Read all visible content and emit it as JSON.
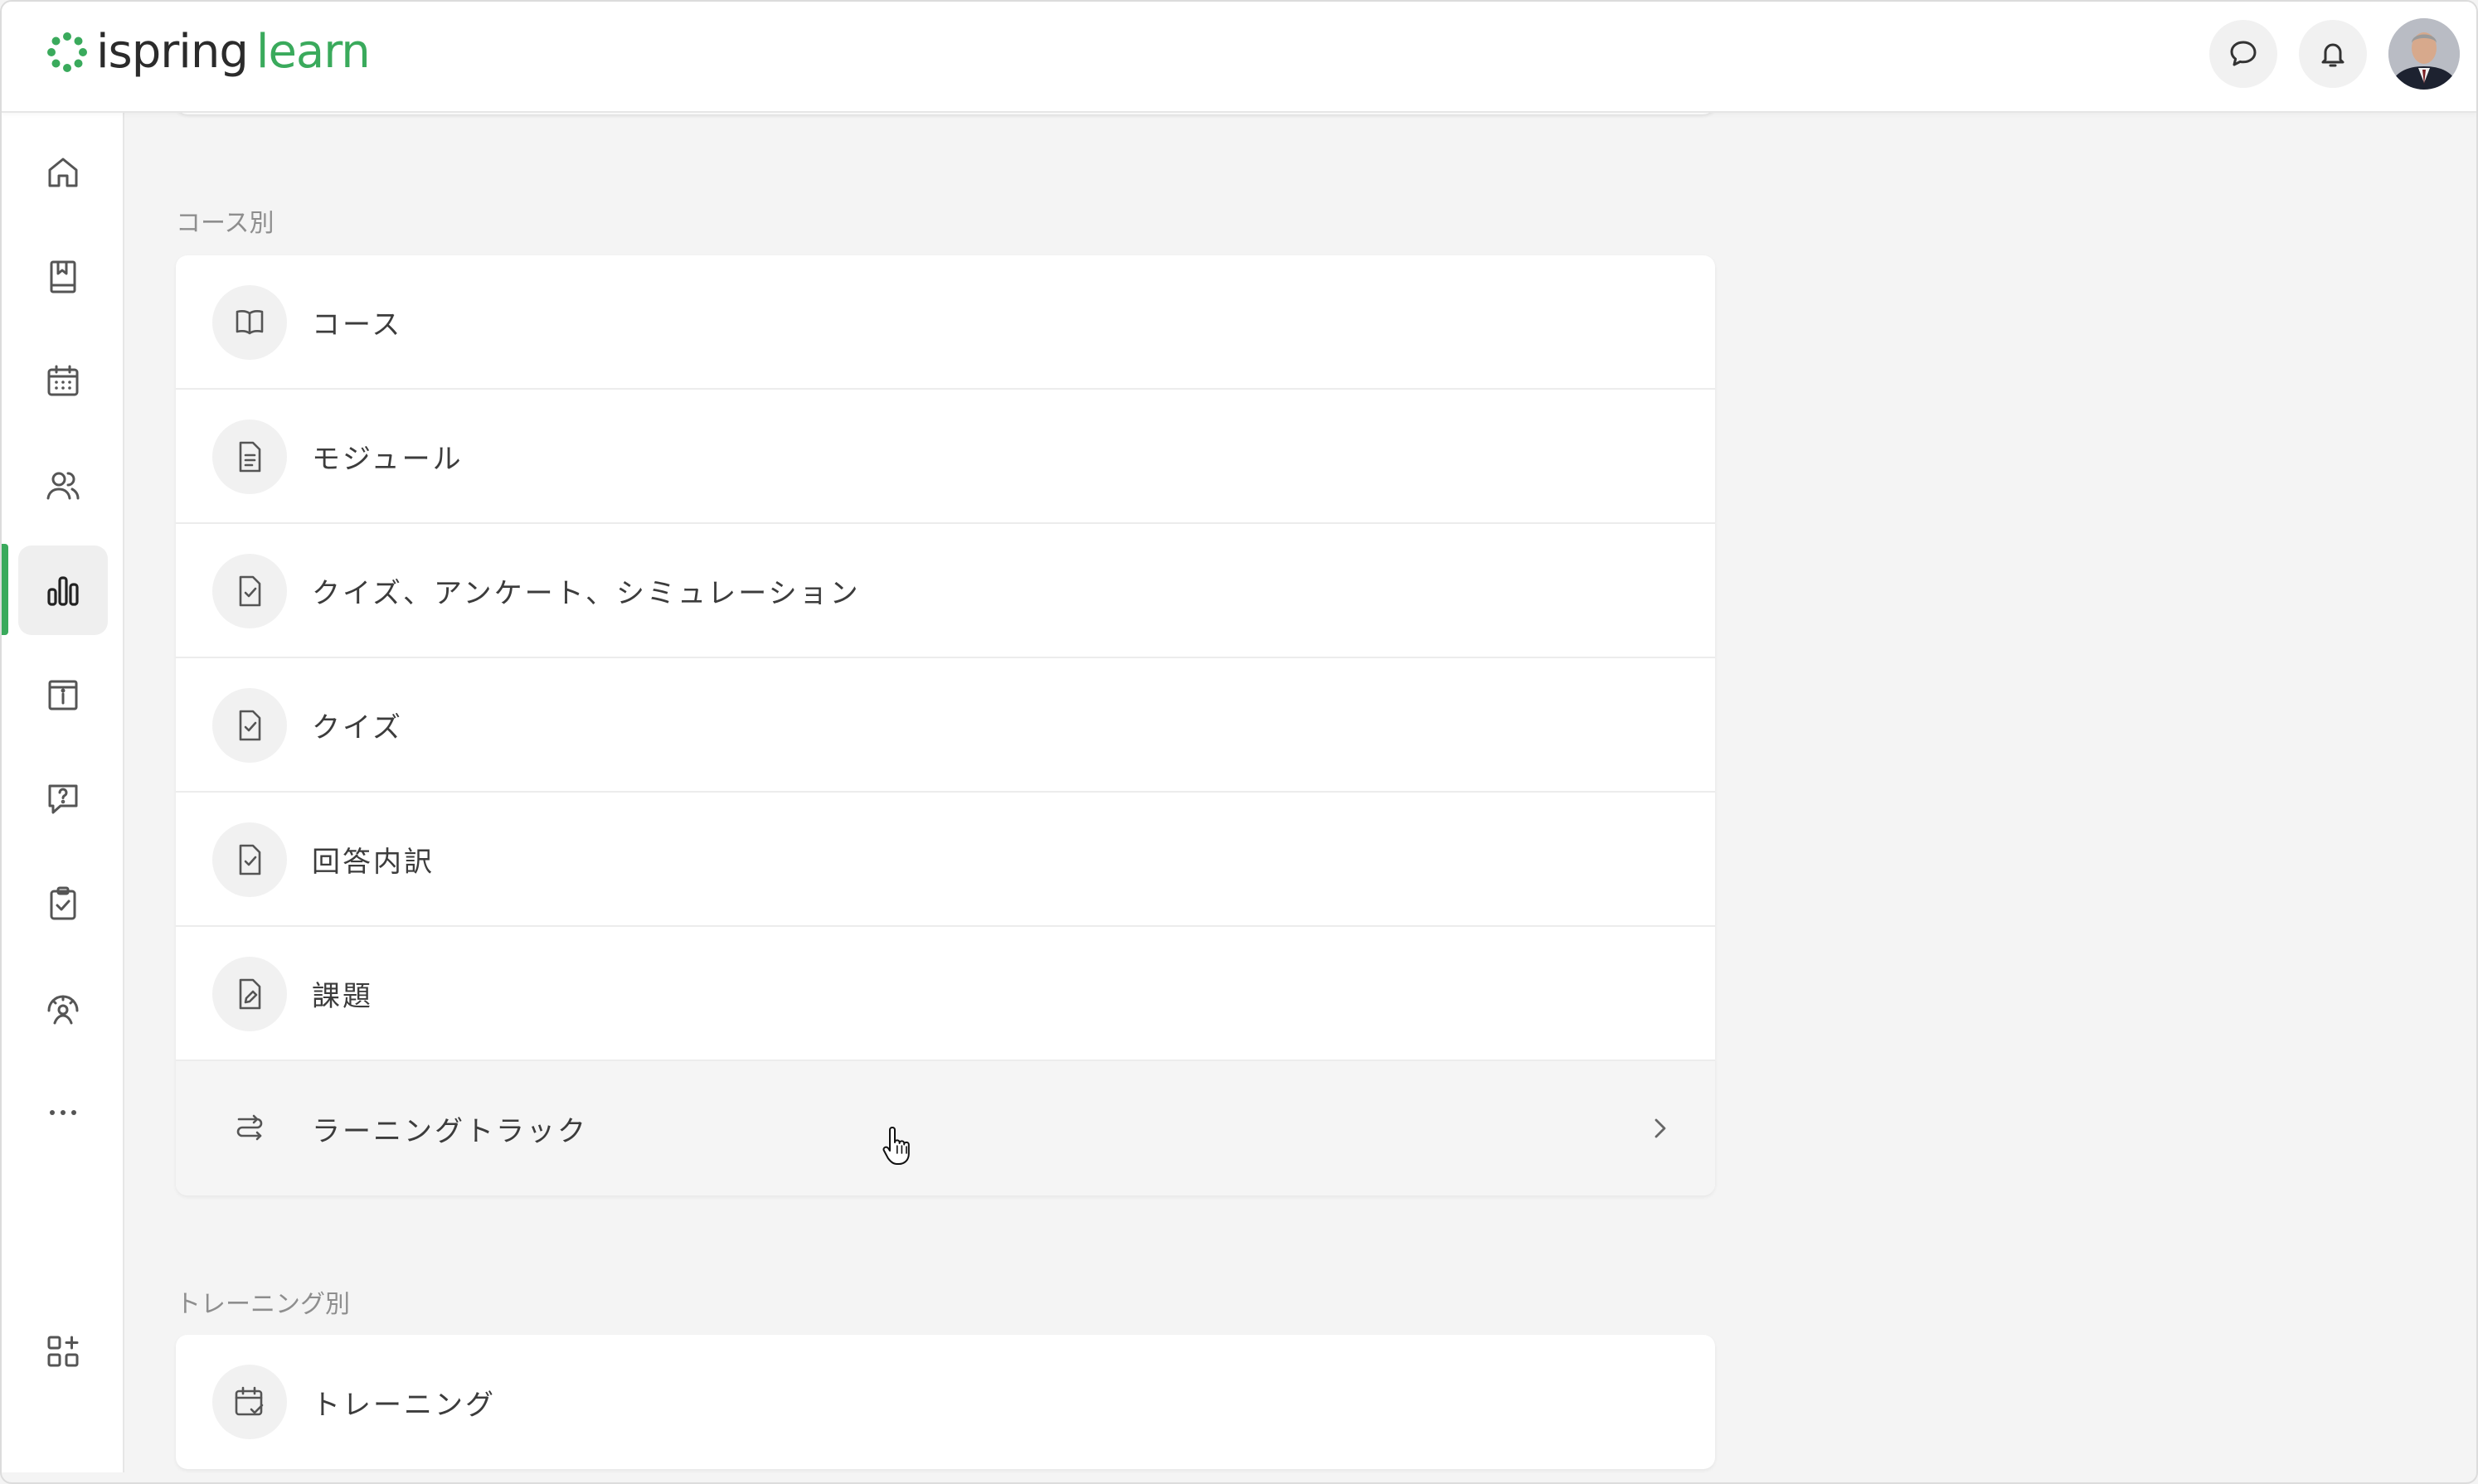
{
  "header": {
    "logo": {
      "part1": "ispring",
      "part2": "learn"
    },
    "chat_icon": "chat-bubble-icon",
    "notifications_icon": "bell-icon",
    "avatar": "user-avatar"
  },
  "sidebar": {
    "items": [
      {
        "name": "home",
        "icon": "home-icon"
      },
      {
        "name": "content",
        "icon": "book-icon"
      },
      {
        "name": "calendar",
        "icon": "calendar-icon"
      },
      {
        "name": "users",
        "icon": "users-icon"
      },
      {
        "name": "reports",
        "icon": "bar-chart-icon",
        "active": true
      },
      {
        "name": "info",
        "icon": "info-board-icon"
      },
      {
        "name": "questions",
        "icon": "question-bubble-icon"
      },
      {
        "name": "tasks",
        "icon": "clipboard-check-icon"
      },
      {
        "name": "gamification",
        "icon": "gauge-user-icon"
      },
      {
        "name": "more",
        "icon": "more-icon"
      },
      {
        "name": "apps",
        "icon": "add-widget-icon"
      }
    ],
    "accent_color": "#3aaa5c"
  },
  "sections": {
    "by_course": {
      "title": "コース別",
      "rows": [
        {
          "label": "コース",
          "icon": "open-book-icon"
        },
        {
          "label": "モジュール",
          "icon": "document-icon"
        },
        {
          "label": "クイズ、アンケート、シミュレーション",
          "icon": "checklist-doc-icon"
        },
        {
          "label": "クイズ",
          "icon": "checklist-doc-icon"
        },
        {
          "label": "回答内訳",
          "icon": "checklist-doc-icon"
        },
        {
          "label": "課題",
          "icon": "edit-doc-icon"
        },
        {
          "label": "ラーニングトラック",
          "icon": "route-icon",
          "has_chevron": true
        }
      ]
    },
    "by_training": {
      "title": "トレーニング別",
      "rows": [
        {
          "label": "トレーニング",
          "icon": "calendar-check-icon"
        }
      ]
    }
  }
}
